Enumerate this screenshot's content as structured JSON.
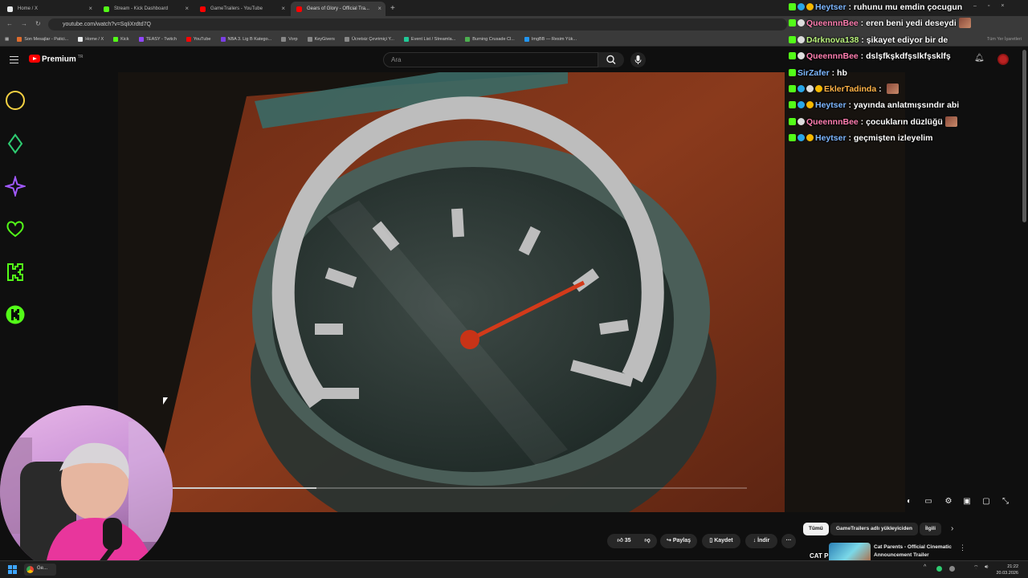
{
  "browser": {
    "tabs": [
      {
        "label": "Home / X",
        "favicon_color": "#e7e9ea",
        "active": false
      },
      {
        "label": "Stream - Kick Dashboard",
        "favicon_color": "#53fc18",
        "active": false
      },
      {
        "label": "GameTrailers - YouTube",
        "favicon_color": "#ff0000",
        "active": false
      },
      {
        "label": "Gears of Glory - Official Tra...",
        "favicon_color": "#ff0000",
        "active": true
      }
    ],
    "new_tab": "+",
    "url": "youtube.com/watch?v=SqIiXrdtd7Q",
    "bookmarks": [
      {
        "label": "Son Mesajlar - Patici...",
        "color": "#e06c2d"
      },
      {
        "label": "Home / X",
        "color": "#e7e9ea"
      },
      {
        "label": "Kick",
        "color": "#53fc18"
      },
      {
        "label": "TEASY - Twitch",
        "color": "#9146ff"
      },
      {
        "label": "YouTube",
        "color": "#ff0000"
      },
      {
        "label": "NBA 3. Lig B Katego...",
        "color": "#7b3fe4"
      },
      {
        "label": "Vorp",
        "color": "#888888"
      },
      {
        "label": "KeyGivers",
        "color": "#888888"
      },
      {
        "label": "Ücretsiz Çevrimiçi Y...",
        "color": "#888888"
      },
      {
        "label": "Event List / Streamla...",
        "color": "#20c997"
      },
      {
        "label": "Burning Crusade Cl...",
        "color": "#4caf50"
      },
      {
        "label": "ImgBB — Resim Yük...",
        "color": "#2196f3"
      }
    ],
    "all_bookmarks": "Tüm Yer İşaretleri"
  },
  "youtube": {
    "brand": "Premium",
    "country": "TR",
    "search_placeholder": "Ara",
    "create_label": "Oluştur",
    "progress_fraction": 0.25,
    "actions": {
      "likes": "35",
      "share": "Paylaş",
      "save": "Kaydet",
      "download": "İndir",
      "more": "···"
    },
    "chips": [
      "Tümü",
      "GameTrailers adlı yükleyiciden",
      "İlgili"
    ],
    "recommended": {
      "title": "Cat Parents - Official Cinematic Announcement Trailer",
      "thumb_label": "CAT P"
    }
  },
  "chat": [
    {
      "user": "Heytser",
      "user_color": "#7db7ff",
      "text": "ruhunu mu emdin çocugun",
      "badges": [
        "k",
        "sub",
        "gold"
      ]
    },
    {
      "user": "QueennnBee",
      "user_color": "#ff7eb0",
      "text": "eren beni yedi deseydi",
      "badges": [
        "k",
        "mod"
      ],
      "emote": true
    },
    {
      "user": "D4rknova138",
      "user_color": "#b9f27c",
      "text": "şikayet ediyor bir de",
      "badges": [
        "k",
        "mod"
      ]
    },
    {
      "user": "QueennnBee",
      "user_color": "#ff7eb0",
      "text": "dslşfkşkdfşslkfşsklfş",
      "badges": [
        "k",
        "mod"
      ]
    },
    {
      "user": "SirZafer",
      "user_color": "#7db7ff",
      "text": "hb",
      "badges": [
        "k"
      ]
    },
    {
      "user": "EklerTadinda",
      "user_color": "#ffb347",
      "text": "",
      "badges": [
        "k",
        "sub",
        "mod",
        "gold"
      ],
      "emote": true
    },
    {
      "user": "Heytser",
      "user_color": "#7db7ff",
      "text": "yayında anlatmışsındır abi",
      "badges": [
        "k",
        "sub",
        "gold"
      ]
    },
    {
      "user": "QueennnBee",
      "user_color": "#ff7eb0",
      "text": "çocukların düzlüğü",
      "badges": [
        "k",
        "mod"
      ],
      "emote": true
    },
    {
      "user": "Heytser",
      "user_color": "#7db7ff",
      "text": "geçmişten izleyelim",
      "badges": [
        "k",
        "sub",
        "gold"
      ]
    }
  ],
  "taskbar": {
    "app_label": "Ge...",
    "time": "21:22",
    "date": "20.03.2026"
  },
  "colors": {
    "kick_green": "#53fc18",
    "youtube_red": "#ff0000",
    "needle": "#d23a1a"
  }
}
